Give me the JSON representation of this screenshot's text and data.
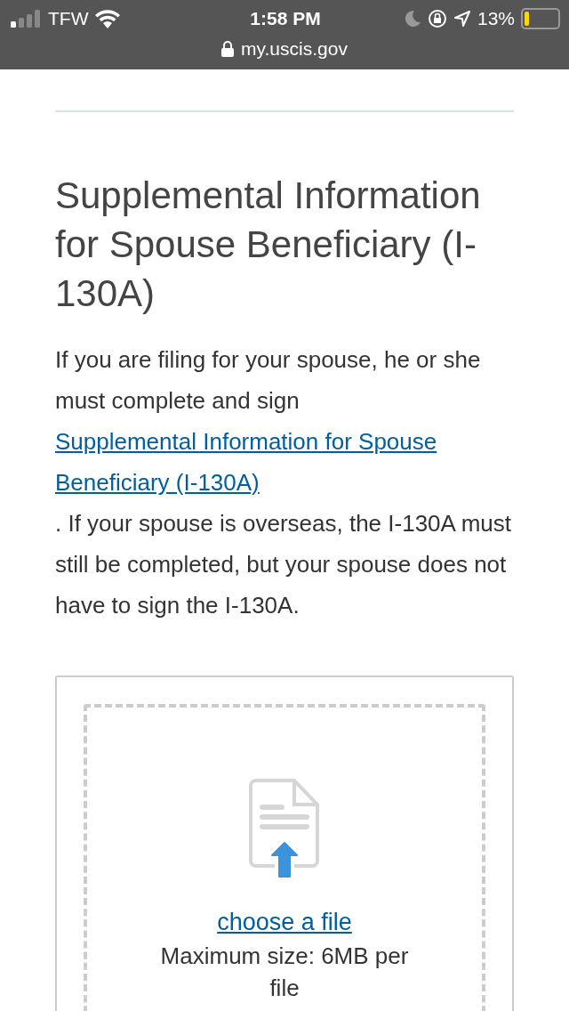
{
  "status_bar": {
    "carrier": "TFW",
    "time": "1:58 PM",
    "battery_percent": "13%"
  },
  "address_bar": {
    "url": "my.uscis.gov"
  },
  "heading": "Supplemental Information for Spouse Beneficiary (I-130A)",
  "paragraph": {
    "before": "If you are filing for your spouse, he or she must complete and sign ",
    "link": "Supplemental Information for Spouse Beneficiary (I-130A)",
    "after": ". If your spouse is overseas, the I-130A must still be completed, but your spouse does not have to sign the I-130A."
  },
  "upload": {
    "link": "choose a file",
    "note": "Maximum size: 6MB per file"
  }
}
